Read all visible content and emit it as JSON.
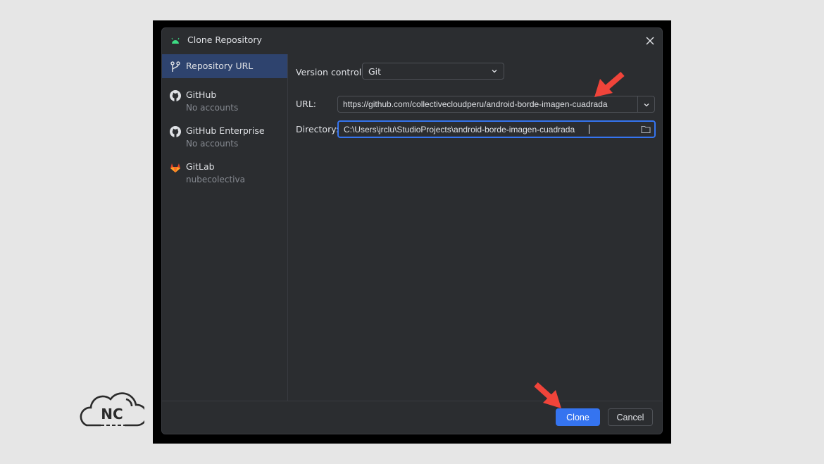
{
  "dialog": {
    "title": "Clone Repository",
    "title_icon": "android-icon",
    "close_icon": "close-icon"
  },
  "sidebar": {
    "items": [
      {
        "label": "Repository URL",
        "sub": "",
        "icon": "git-branch-icon",
        "active": true
      },
      {
        "label": "GitHub",
        "sub": "No accounts",
        "icon": "github-icon"
      },
      {
        "label": "GitHub Enterprise",
        "sub": "No accounts",
        "icon": "github-icon"
      },
      {
        "label": "GitLab",
        "sub": "nubecolectiva",
        "icon": "gitlab-icon"
      }
    ]
  },
  "form": {
    "version_control_label": "Version control:",
    "version_control_value": "Git",
    "url_label": "URL:",
    "url_value": "https://github.com/collectivecloudperu/android-borde-imagen-cuadrada",
    "directory_label": "Directory:",
    "directory_value": "C:\\Users\\jrclu\\StudioProjects\\android-borde-imagen-cuadrada"
  },
  "footer": {
    "clone_label": "Clone",
    "cancel_label": "Cancel"
  },
  "watermark": {
    "text": "NC"
  },
  "colors": {
    "accent": "#3574f0",
    "annotation_arrow": "#f0443a",
    "dialog_bg": "#2b2d30",
    "selected_item": "#2e436e"
  }
}
